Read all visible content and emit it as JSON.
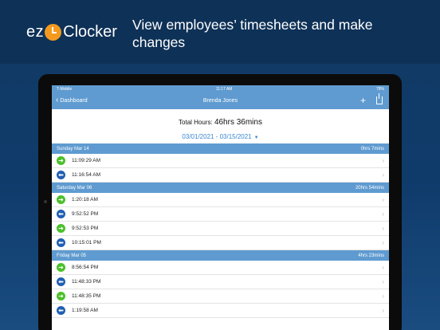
{
  "brand": {
    "ez": "ez",
    "clocker": "Clocker",
    "accent": "#f39a1e"
  },
  "headline": "View employees’ timesheets and make changes",
  "status_bar": {
    "carrier": "T-Mobile",
    "time": "11:17 AM",
    "battery": "78%"
  },
  "nav": {
    "back_label": "Dashboard",
    "title": "Brenda Jones"
  },
  "summary": {
    "total_label": "Total Hours:",
    "total_value": "46hrs 36mins",
    "date_range": "03/01/2021 - 03/15/2021"
  },
  "days": [
    {
      "label": "Sunday Mar 14",
      "total": "0hrs 7mins",
      "entries": [
        {
          "type": "in",
          "time": "11:09:29 AM"
        },
        {
          "type": "out",
          "time": "11:16:54 AM"
        }
      ]
    },
    {
      "label": "Saturday Mar 06",
      "total": "20hrs 54mins",
      "entries": [
        {
          "type": "in",
          "time": "1:20:18 AM"
        },
        {
          "type": "out",
          "time": "9:52:52 PM"
        },
        {
          "type": "in",
          "time": "9:52:53 PM"
        },
        {
          "type": "out",
          "time": "10:15:01 PM"
        }
      ]
    },
    {
      "label": "Friday Mar 05",
      "total": "4hrs 23mins",
      "entries": [
        {
          "type": "in",
          "time": "8:56:54 PM"
        },
        {
          "type": "out",
          "time": "11:48:33 PM"
        },
        {
          "type": "in",
          "time": "11:48:35 PM"
        },
        {
          "type": "out",
          "time": "1:19:58 AM"
        }
      ]
    }
  ],
  "colors": {
    "clock_in": "#4bbf2b",
    "clock_out": "#1f5fb3",
    "header_blue": "#5f9bd0",
    "link_blue": "#3a86d2"
  }
}
